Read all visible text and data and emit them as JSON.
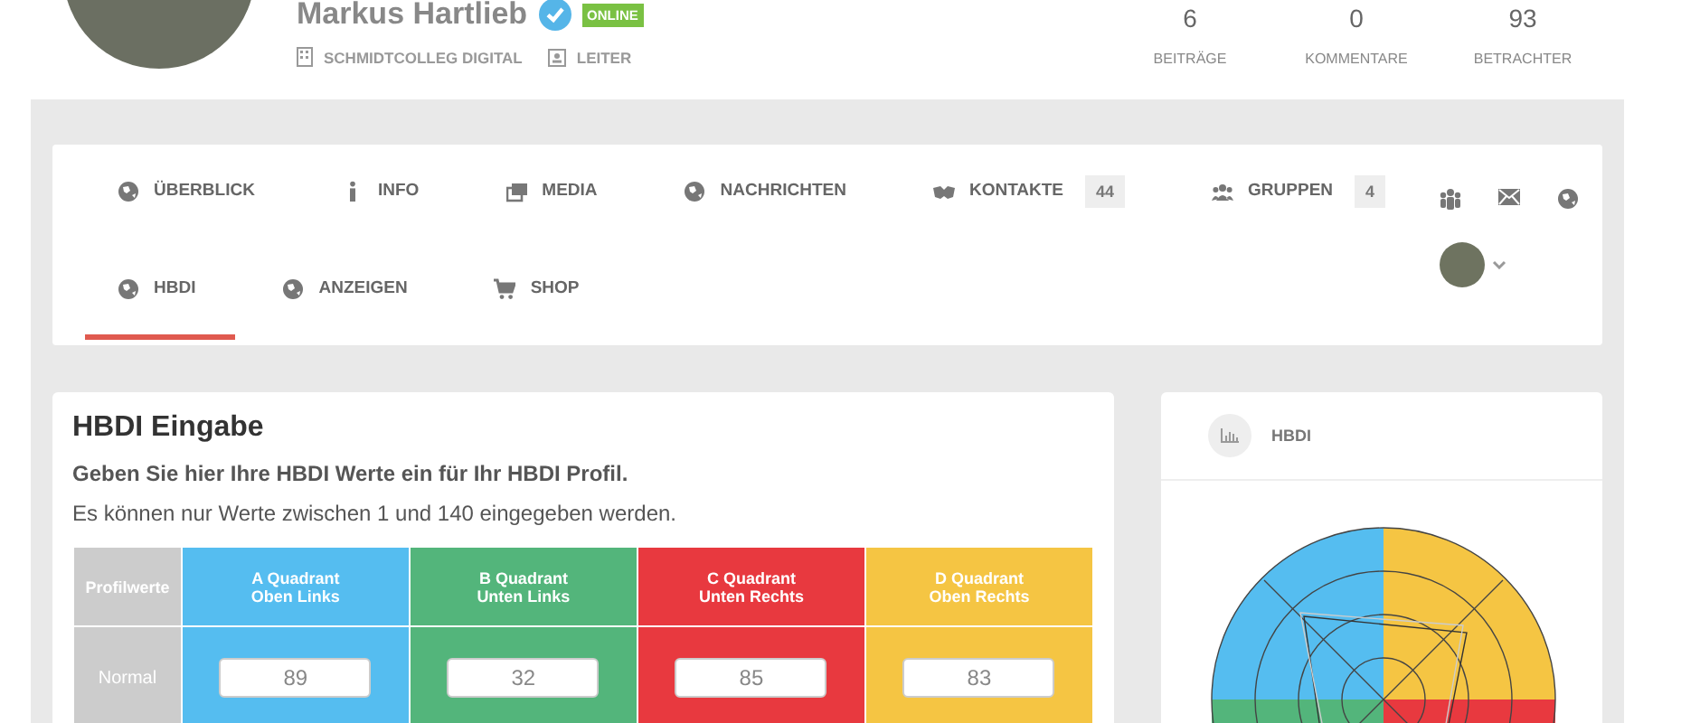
{
  "profile": {
    "name": "Markus Hartlieb",
    "verified": true,
    "status": "ONLINE",
    "company": "SCHMIDTCOLLEG DIGITAL",
    "role": "LEITER"
  },
  "stats": [
    {
      "value": "6",
      "label": "BEITRÄGE"
    },
    {
      "value": "0",
      "label": "KOMMENTARE"
    },
    {
      "value": "93",
      "label": "BETRACHTER"
    }
  ],
  "tab_rows": [
    [
      {
        "label": "ÜBERBLICK",
        "selected": false
      },
      {
        "label": "INFO",
        "selected": false
      },
      {
        "label": "MEDIA",
        "selected": false
      },
      {
        "label": "NACHRICHTEN",
        "selected": false
      },
      {
        "label": "KONTAKTE",
        "count": "44",
        "selected": false
      },
      {
        "label": "GRUPPEN",
        "count": "4",
        "selected": false
      }
    ],
    [
      {
        "label": "HBDI",
        "selected": true
      },
      {
        "label": "ANZEIGEN",
        "selected": false
      },
      {
        "label": "SHOP",
        "selected": false
      }
    ]
  ],
  "hbdi_input": {
    "title": "HBDI Eingabe",
    "subtitle": "Geben Sie hier Ihre HBDI Werte ein für Ihr HBDI Profil.",
    "hint": "Es können nur Werte zwischen 1 und 140 eingegeben werden.",
    "table": {
      "columns": [
        {
          "line1": "Profilwerte",
          "color": "#cccccc"
        },
        {
          "line1": "A Quadrant",
          "line2": "Oben Links",
          "color": "#55bdf0"
        },
        {
          "line1": "B Quadrant",
          "line2": "Unten Links",
          "color": "#53b57b"
        },
        {
          "line1": "C Quadrant",
          "line2": "Unten Rechts",
          "color": "#e8393f"
        },
        {
          "line1": "D Quadrant",
          "line2": "Oben Rechts",
          "color": "#f5c543"
        }
      ],
      "rows": [
        {
          "label": "Normal",
          "values": [
            "89",
            "32",
            "85",
            "83"
          ]
        }
      ]
    }
  },
  "hbdi_panel": {
    "title": "HBDI"
  }
}
